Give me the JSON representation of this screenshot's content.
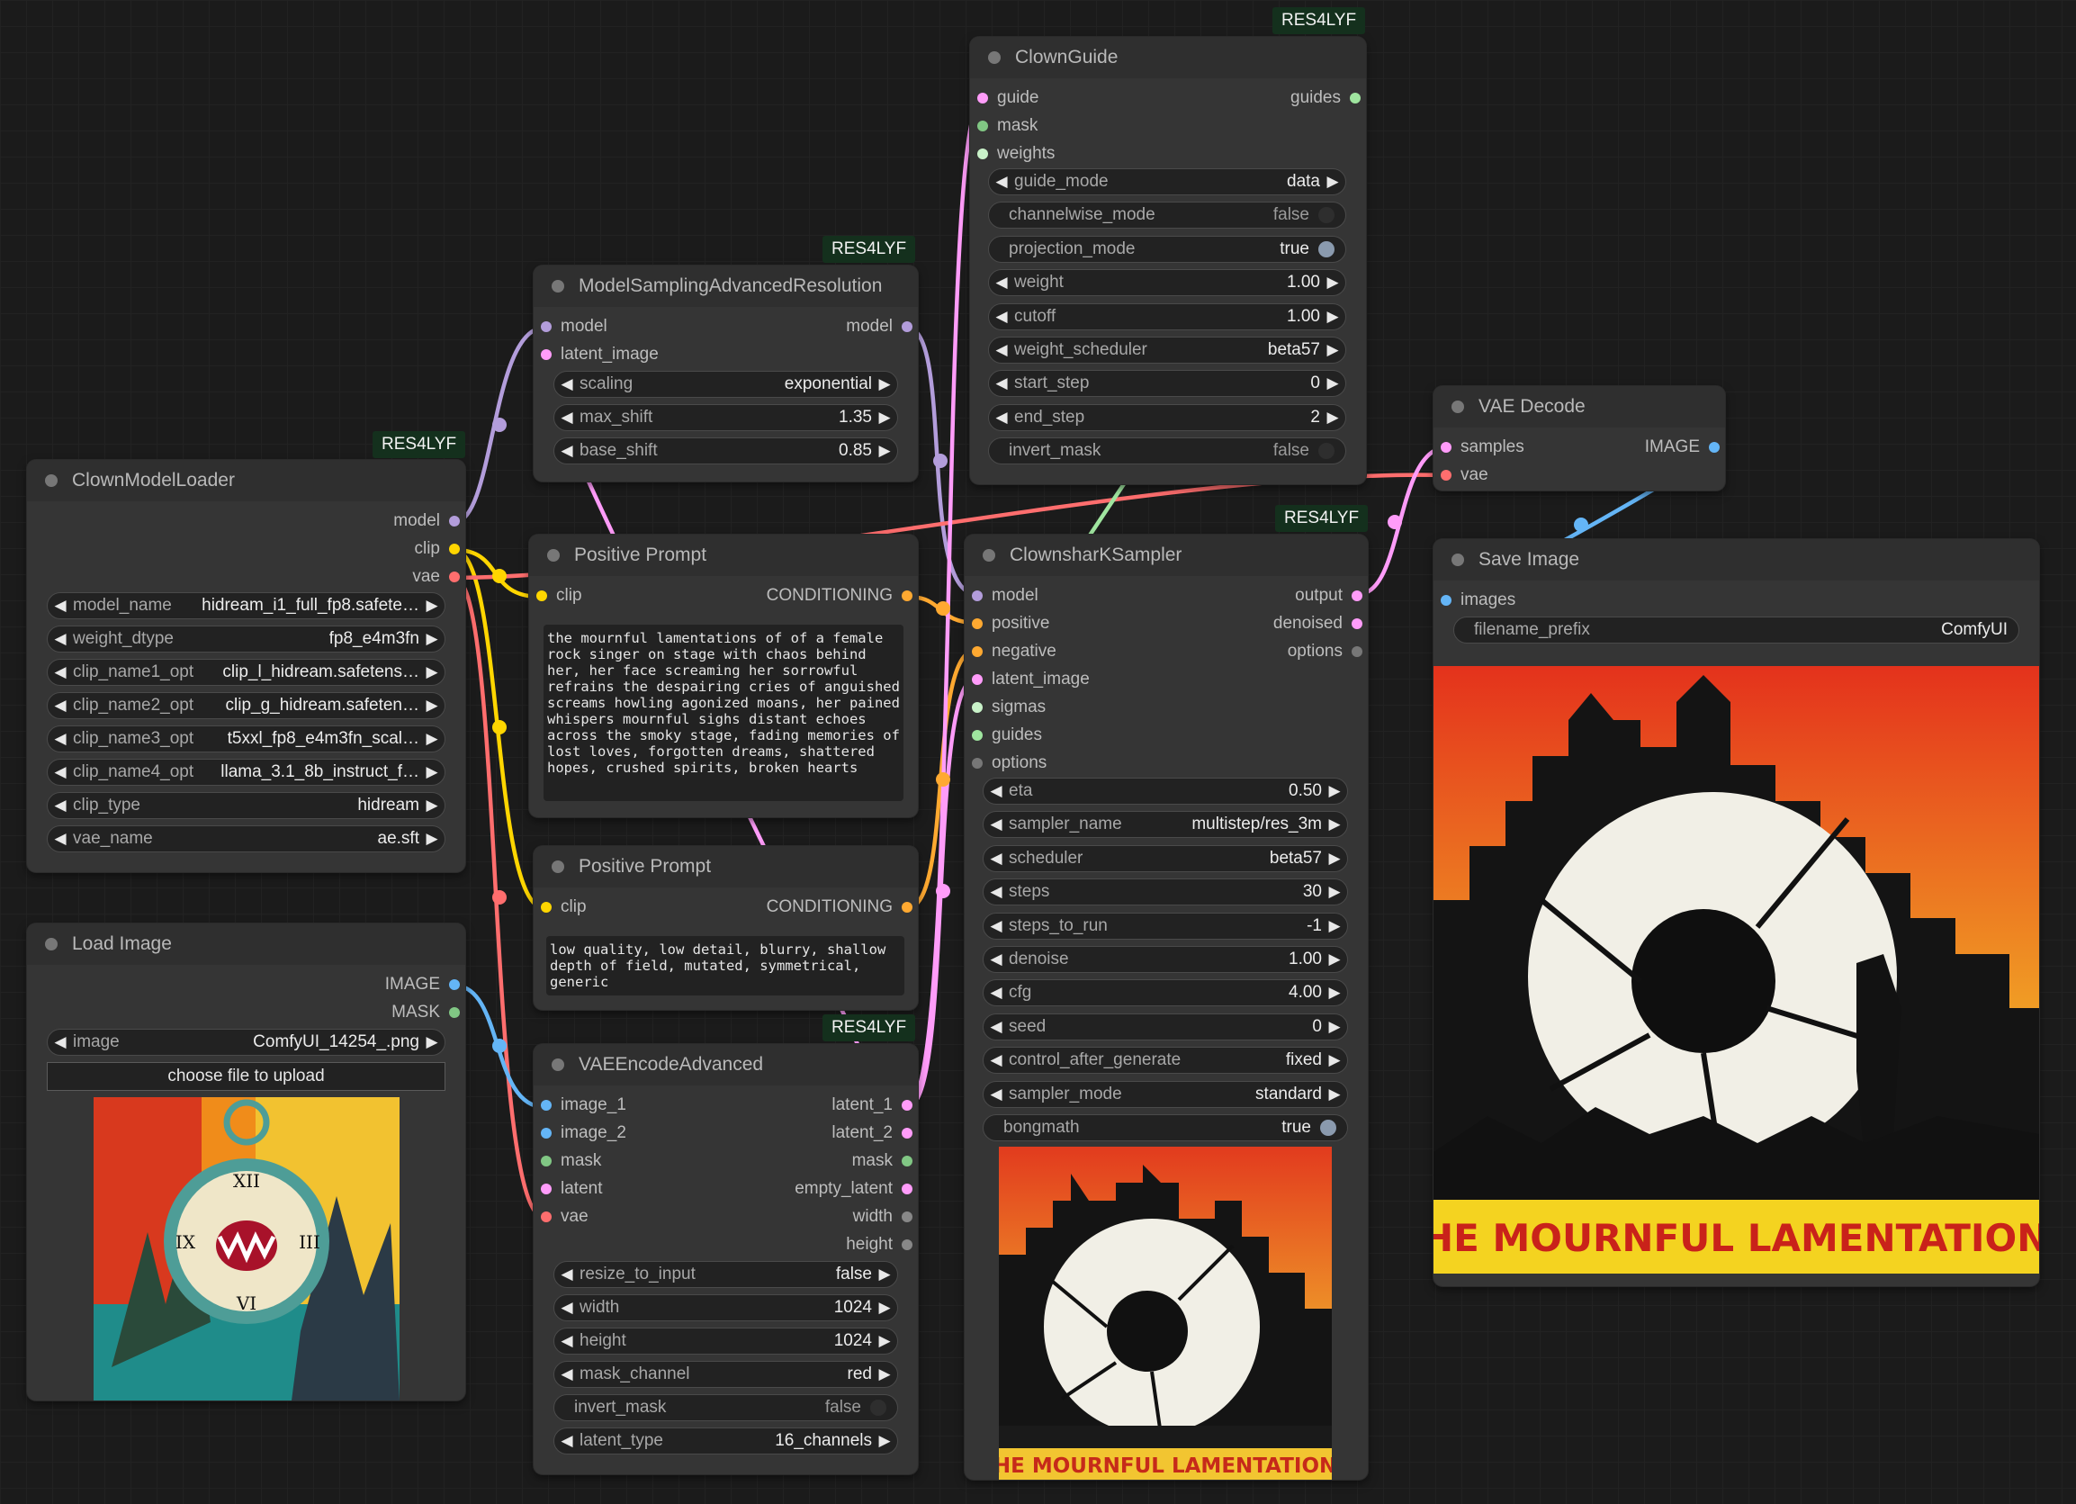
{
  "colors": {
    "model": "#b39ddb",
    "clip": "#ffd600",
    "vae": "#ff6e6e",
    "image": "#64b5f6",
    "mask": "#81c784",
    "latent": "#ff9cf9",
    "conditioning": "#ffa931",
    "guides": "#9fe59f",
    "options": "#777777"
  },
  "badges": {
    "guide": "RES4LYF",
    "msar": "RES4LYF",
    "loader": "RES4LYF",
    "sampler": "RES4LYF",
    "vaeenc": "RES4LYF"
  },
  "loader": {
    "title": "ClownModelLoader",
    "outputs": [
      "model",
      "clip",
      "vae"
    ],
    "widgets": [
      {
        "name": "model_name",
        "value": "hidream_i1_full_fp8.safete…"
      },
      {
        "name": "weight_dtype",
        "value": "fp8_e4m3fn"
      },
      {
        "name": "clip_name1_opt",
        "value": "clip_l_hidream.safetens…"
      },
      {
        "name": "clip_name2_opt",
        "value": "clip_g_hidream.safeten…"
      },
      {
        "name": "clip_name3_opt",
        "value": "t5xxl_fp8_e4m3fn_scal…"
      },
      {
        "name": "clip_name4_opt",
        "value": "llama_3.1_8b_instruct_f…"
      },
      {
        "name": "clip_type",
        "value": "hidream"
      },
      {
        "name": "vae_name",
        "value": "ae.sft"
      }
    ]
  },
  "loadimage": {
    "title": "Load Image",
    "outputs": [
      "IMAGE",
      "MASK"
    ],
    "image_widget": {
      "name": "image",
      "value": "ComfyUI_14254_.png"
    },
    "upload_label": "choose file to upload"
  },
  "msar": {
    "title": "ModelSamplingAdvancedResolution",
    "inputs": [
      "model",
      "latent_image"
    ],
    "outputs": [
      "model"
    ],
    "widgets": [
      {
        "name": "scaling",
        "value": "exponential"
      },
      {
        "name": "max_shift",
        "value": "1.35"
      },
      {
        "name": "base_shift",
        "value": "0.85"
      }
    ]
  },
  "pos1": {
    "title": "Positive Prompt",
    "input": "clip",
    "output": "CONDITIONING",
    "text": "the mournful lamentations of of a female\nrock singer on stage with chaos behind\nher, her face screaming her sorrowful\nrefrains the despairing cries of anguished\nscreams howling agonized moans, her pained\nwhispers mournful sighs distant echoes\nacross the smoky stage, fading memories of\nlost loves, forgotten dreams, shattered\nhopes, crushed spirits, broken hearts"
  },
  "pos2": {
    "title": "Positive Prompt",
    "input": "clip",
    "output": "CONDITIONING",
    "text": "low quality, low detail, blurry, shallow\ndepth of field, mutated, symmetrical,\ngeneric"
  },
  "vaeenc": {
    "title": "VAEEncodeAdvanced",
    "inputs": [
      "image_1",
      "image_2",
      "mask",
      "latent",
      "vae"
    ],
    "outputs": [
      "latent_1",
      "latent_2",
      "mask",
      "empty_latent",
      "width",
      "height"
    ],
    "widgets": [
      {
        "name": "resize_to_input",
        "value": "false"
      },
      {
        "name": "width",
        "value": "1024"
      },
      {
        "name": "height",
        "value": "1024"
      },
      {
        "name": "mask_channel",
        "value": "red"
      }
    ],
    "toggle": {
      "name": "invert_mask",
      "value": "false"
    },
    "widgets2": [
      {
        "name": "latent_type",
        "value": "16_channels"
      }
    ]
  },
  "guide": {
    "title": "ClownGuide",
    "inputs": [
      "guide",
      "mask",
      "weights"
    ],
    "outputs": [
      "guides"
    ],
    "widgets": [
      {
        "type": "combo",
        "name": "guide_mode",
        "value": "data"
      },
      {
        "type": "toggle",
        "name": "channelwise_mode",
        "value": "false"
      },
      {
        "type": "toggle",
        "name": "projection_mode",
        "value": "true"
      },
      {
        "type": "combo",
        "name": "weight",
        "value": "1.00"
      },
      {
        "type": "combo",
        "name": "cutoff",
        "value": "1.00"
      },
      {
        "type": "combo",
        "name": "weight_scheduler",
        "value": "beta57"
      },
      {
        "type": "combo",
        "name": "start_step",
        "value": "0"
      },
      {
        "type": "combo",
        "name": "end_step",
        "value": "2"
      },
      {
        "type": "toggle",
        "name": "invert_mask",
        "value": "false"
      }
    ]
  },
  "sampler": {
    "title": "ClownsharKSampler",
    "inputs": [
      "model",
      "positive",
      "negative",
      "latent_image",
      "sigmas",
      "guides",
      "options"
    ],
    "outputs": [
      "output",
      "denoised",
      "options"
    ],
    "widgets": [
      {
        "type": "combo",
        "name": "eta",
        "value": "0.50"
      },
      {
        "type": "combo",
        "name": "sampler_name",
        "value": "multistep/res_3m"
      },
      {
        "type": "combo",
        "name": "scheduler",
        "value": "beta57"
      },
      {
        "type": "combo",
        "name": "steps",
        "value": "30"
      },
      {
        "type": "combo",
        "name": "steps_to_run",
        "value": "-1"
      },
      {
        "type": "combo",
        "name": "denoise",
        "value": "1.00"
      },
      {
        "type": "combo",
        "name": "cfg",
        "value": "4.00"
      },
      {
        "type": "combo",
        "name": "seed",
        "value": "0"
      },
      {
        "type": "combo",
        "name": "control_after_generate",
        "value": "fixed"
      },
      {
        "type": "combo",
        "name": "sampler_mode",
        "value": "standard"
      },
      {
        "type": "toggle",
        "name": "bongmath",
        "value": "true"
      }
    ],
    "preview_caption": "THE MOURNFUL LAMENTATIONS"
  },
  "vaedecode": {
    "title": "VAE Decode",
    "inputs": [
      "samples",
      "vae"
    ],
    "outputs": [
      "IMAGE"
    ]
  },
  "save": {
    "title": "Save Image",
    "inputs": [
      "images"
    ],
    "widget": {
      "name": "filename_prefix",
      "value": "ComfyUI"
    },
    "caption": "THE MOURNFUL LAMENTATIONS"
  }
}
